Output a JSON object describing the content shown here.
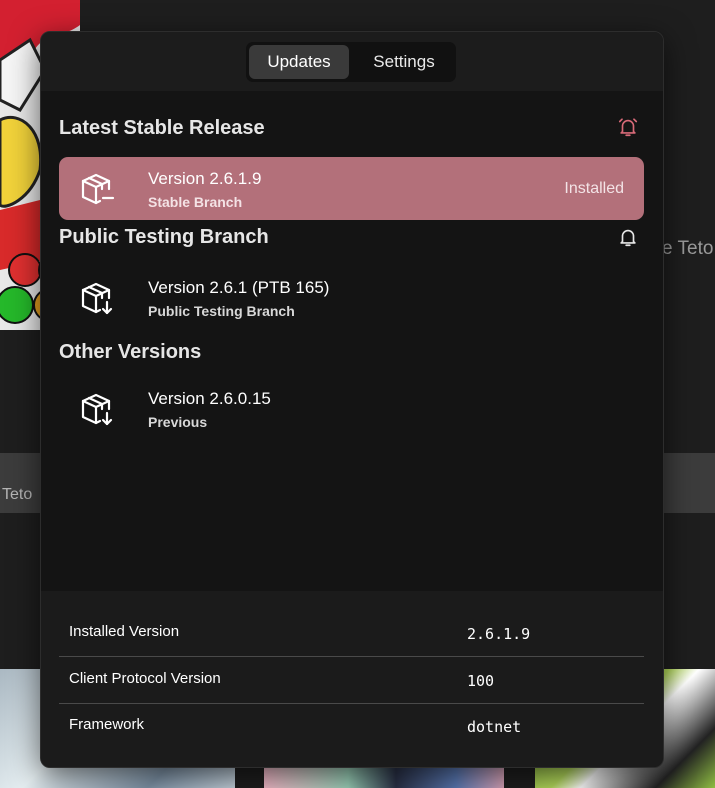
{
  "background": {
    "right_text": "e Teto",
    "band_text": "Teto"
  },
  "tabs": [
    {
      "label": "Updates",
      "active": true
    },
    {
      "label": "Settings",
      "active": false
    }
  ],
  "sections": {
    "stable": {
      "title": "Latest Stable Release",
      "bell_icon": "bell-ringing-icon",
      "bell_color": "#d86a78",
      "release": {
        "version": "Version 2.6.1.9",
        "branch": "Stable Branch",
        "status": "Installed",
        "icon": "package-installed-icon"
      }
    },
    "ptb": {
      "title": "Public Testing Branch",
      "bell_icon": "bell-icon",
      "release": {
        "version": "Version 2.6.1 (PTB 165)",
        "branch": "Public Testing Branch",
        "icon": "package-download-icon"
      }
    },
    "other": {
      "title": "Other Versions",
      "release": {
        "version": "Version 2.6.0.15",
        "branch": "Previous",
        "icon": "package-download-icon"
      }
    }
  },
  "info": [
    {
      "key": "Installed Version",
      "value": "2.6.1.9"
    },
    {
      "key": "Client Protocol Version",
      "value": "100"
    },
    {
      "key": "Framework",
      "value": "dotnet"
    }
  ],
  "colors": {
    "installed_row": "#b3707a",
    "popup_bg": "#141414"
  }
}
